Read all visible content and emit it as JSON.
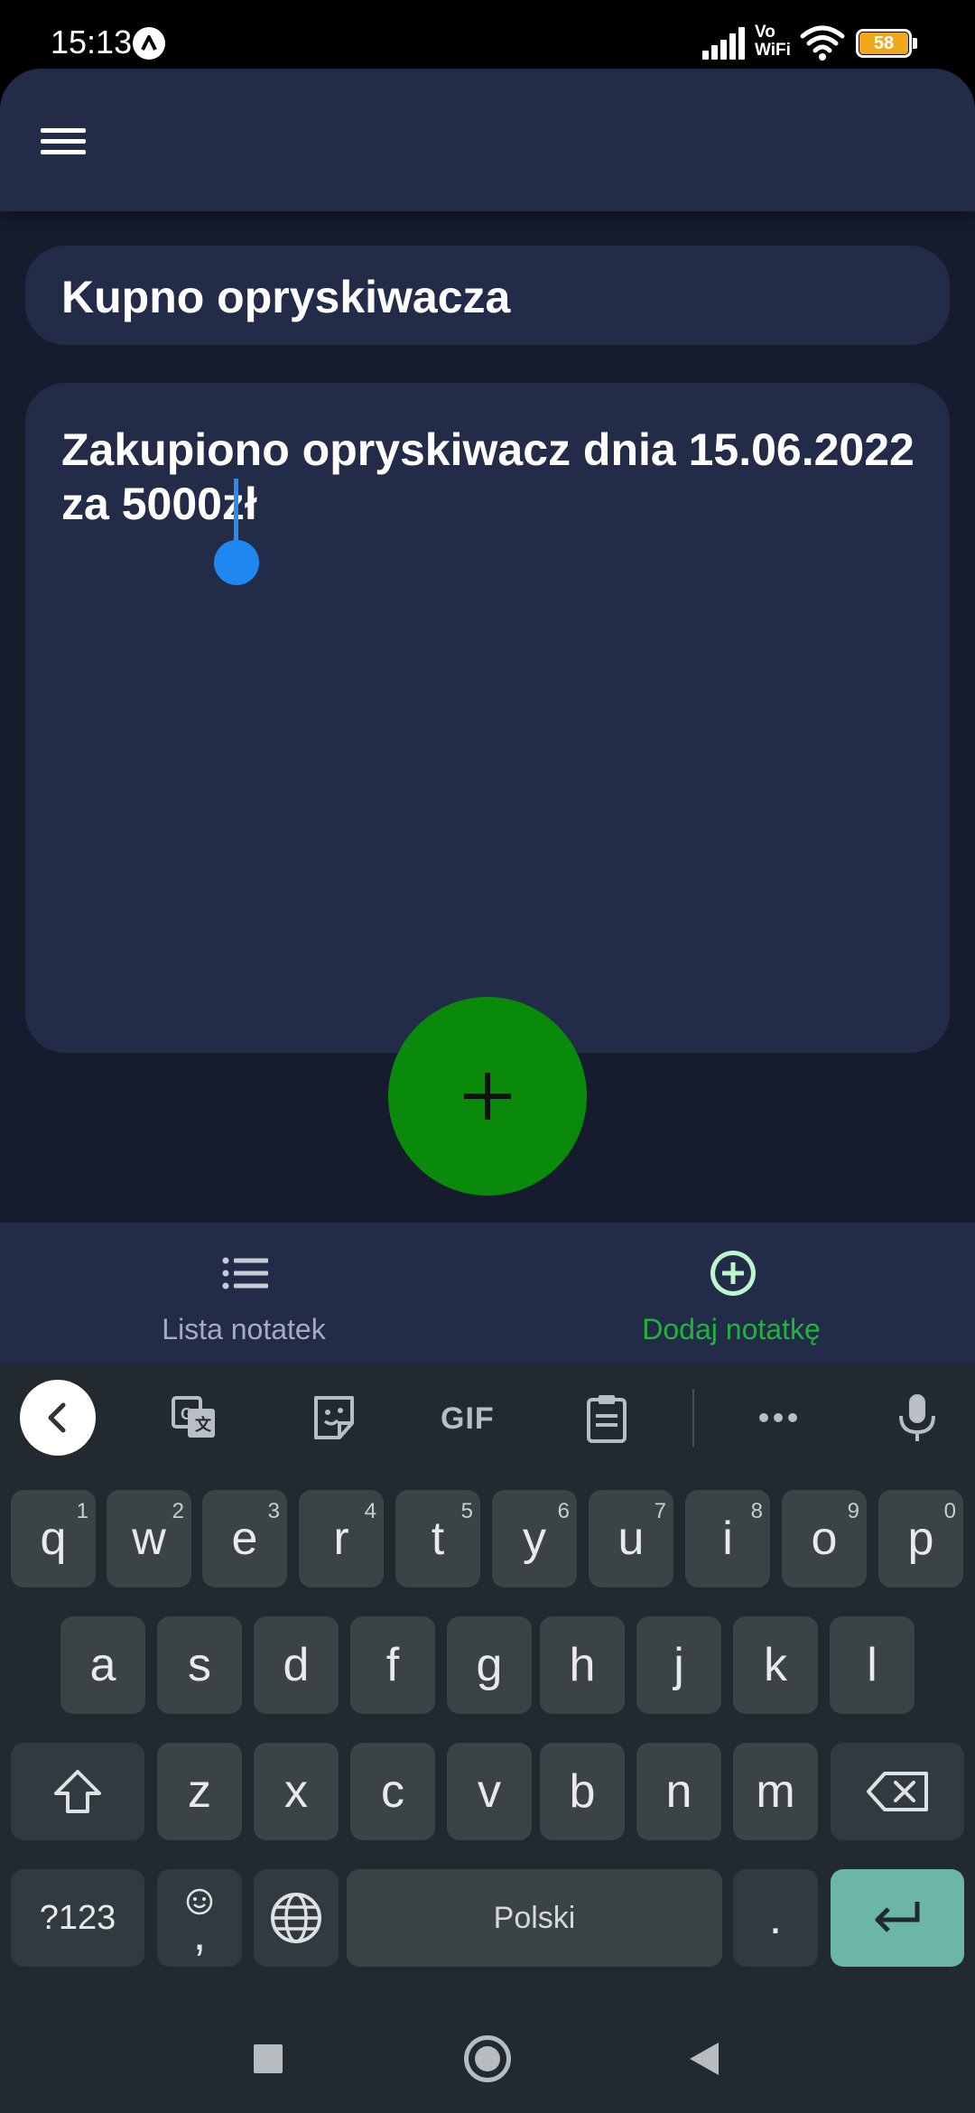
{
  "status_bar": {
    "time": "15:13",
    "network_label_top": "Vo",
    "network_label_bottom": "WiFi",
    "battery": "58",
    "battery_color": "#f2a81d"
  },
  "app": {
    "menu_icon": "hamburger-menu-icon",
    "title_value": "Kupno opryskiwacza",
    "note_value": "Zakupiono opryskiwacz dnia 15.06.2022 za 5000zł",
    "fab_icon": "plus-icon",
    "fab_color": "#0a8a0a",
    "bottom_nav": [
      {
        "label": "Lista notatek",
        "icon": "list-icon",
        "active": false
      },
      {
        "label": "Dodaj notatkę",
        "icon": "add-circle-icon",
        "active": true
      }
    ],
    "accent_active": "#22b33a"
  },
  "keyboard": {
    "toolbar_icons": [
      "back-chevron-icon",
      "translate-icon",
      "sticker-icon",
      "gif-icon",
      "clipboard-icon",
      "more-icon",
      "microphone-icon"
    ],
    "gif_label": "GIF",
    "row1": [
      {
        "k": "q",
        "h": "1"
      },
      {
        "k": "w",
        "h": "2"
      },
      {
        "k": "e",
        "h": "3"
      },
      {
        "k": "r",
        "h": "4"
      },
      {
        "k": "t",
        "h": "5"
      },
      {
        "k": "y",
        "h": "6"
      },
      {
        "k": "u",
        "h": "7"
      },
      {
        "k": "i",
        "h": "8"
      },
      {
        "k": "o",
        "h": "9"
      },
      {
        "k": "p",
        "h": "0"
      }
    ],
    "row2": [
      "a",
      "s",
      "d",
      "f",
      "g",
      "h",
      "j",
      "k",
      "l"
    ],
    "row3": [
      "z",
      "x",
      "c",
      "v",
      "b",
      "n",
      "m"
    ],
    "symbols_label": "?123",
    "emoji_comma": ",",
    "space_label": "Polski",
    "period_label": ".",
    "enter_color": "#6cb6a8"
  },
  "system_nav": [
    "recents-square-icon",
    "home-circle-icon",
    "back-triangle-icon"
  ]
}
